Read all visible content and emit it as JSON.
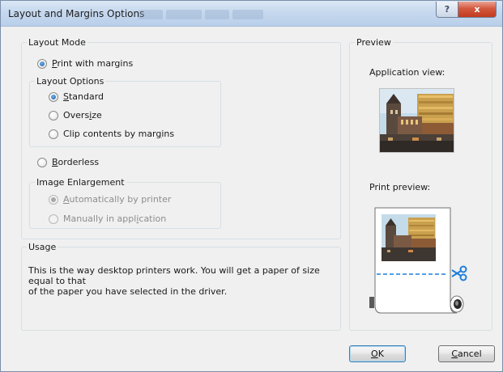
{
  "window": {
    "title": "Layout and Margins Options",
    "help_glyph": "?",
    "close_glyph": "x"
  },
  "layout_mode": {
    "group_title": "Layout Mode",
    "print_with_margins": {
      "prefix": "P",
      "rest": "rint with margins",
      "checked": true
    },
    "layout_options": {
      "group_title": "Layout Options",
      "standard": {
        "prefix": "S",
        "rest": "tandard",
        "checked": true
      },
      "oversize": {
        "before": "Overs",
        "key": "i",
        "after": "ze",
        "checked": false
      },
      "clip": {
        "before": "Clip contents by mar",
        "key": "g",
        "after": "ins",
        "checked": false
      }
    },
    "borderless": {
      "prefix": "B",
      "rest": "orderless",
      "checked": false
    },
    "image_enlargement": {
      "group_title": "Image Enlargement",
      "auto": {
        "prefix": "A",
        "rest": "utomatically by printer",
        "checked": true,
        "disabled": true
      },
      "manual": {
        "before": "Manually in appl",
        "key": "i",
        "after": "cation",
        "checked": false,
        "disabled": true
      }
    }
  },
  "usage": {
    "group_title": "Usage",
    "text_line1": "This is the way desktop printers work. You will get a paper of size equal to that",
    "text_line2": "of the paper you have selected in the driver."
  },
  "preview": {
    "group_title": "Preview",
    "application_view_label": "Application view:",
    "print_preview_label": "Print preview:",
    "cut_line_color": "#1e7fd8"
  },
  "buttons": {
    "ok": {
      "prefix": "O",
      "rest": "K"
    },
    "cancel": {
      "prefix": "C",
      "rest": "ancel"
    }
  }
}
